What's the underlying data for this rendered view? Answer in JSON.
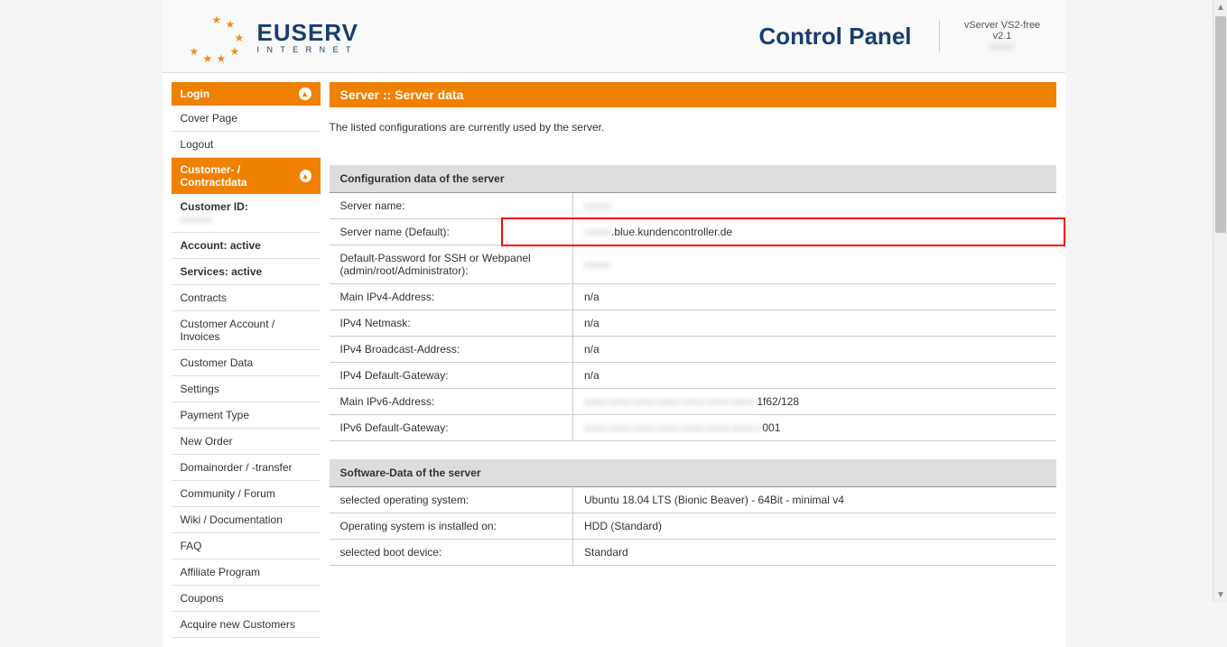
{
  "header": {
    "logo_main": "EUSERV",
    "logo_sub": "I N T E R N E T",
    "title": "Control Panel",
    "version_line1": "vServer VS2-free",
    "version_line2": "v2.1",
    "version_blur": "xxxxx"
  },
  "sidebar": {
    "login": {
      "header": "Login",
      "items": [
        "Cover Page",
        "Logout"
      ]
    },
    "customer": {
      "header": "Customer- / Contractdata",
      "customer_id_label": "Customer ID:",
      "customer_id_value": "xxxxxx",
      "account_label": "Account: active",
      "services_label": "Services: active",
      "items": [
        "Contracts",
        "Customer Account / Invoices",
        "Customer Data",
        "Settings",
        "Payment Type",
        "New Order",
        "Domainorder / -transfer",
        "Community / Forum",
        "Wiki / Documentation",
        "FAQ",
        "Affiliate Program",
        "Coupons",
        "Acquire new Customers"
      ]
    }
  },
  "content": {
    "header": "Server :: Server data",
    "description": "The listed configurations are currently used by the server.",
    "config_table": {
      "title": "Configuration data of the server",
      "rows": [
        {
          "label": "Server name:",
          "value": "xxxxx",
          "blur": true
        },
        {
          "label": "Server name (Default):",
          "value": ".blue.kundencontroller.de",
          "prefix_blur": "xxxxx",
          "highlight": true
        },
        {
          "label": "Default-Password for SSH or Webpanel (admin/root/Administrator):",
          "value": "xxxxx",
          "blur": true
        },
        {
          "label": "Main IPv4-Address:",
          "value": "n/a"
        },
        {
          "label": "IPv4 Netmask:",
          "value": "n/a"
        },
        {
          "label": "IPv4 Broadcast-Address:",
          "value": "n/a"
        },
        {
          "label": "IPv4 Default-Gateway:",
          "value": "n/a"
        },
        {
          "label": "Main IPv6-Address:",
          "value": "1f62/128",
          "prefix_blur": "xxxx:xxxx:xxxx:xxxx:xxxx:xxxx:xxxx:"
        },
        {
          "label": "IPv6 Default-Gateway:",
          "value": "001",
          "prefix_blur": "xxxx:xxxx:xxxx:xxxx:xxxx:xxxx:xxxx:x"
        }
      ]
    },
    "software_table": {
      "title": "Software-Data of the server",
      "rows": [
        {
          "label": "selected operating system:",
          "value": "Ubuntu 18.04 LTS (Bionic Beaver) - 64Bit - minimal v4"
        },
        {
          "label": "Operating system is installed on:",
          "value": "HDD (Standard)"
        },
        {
          "label": "selected boot device:",
          "value": "Standard"
        }
      ]
    }
  }
}
